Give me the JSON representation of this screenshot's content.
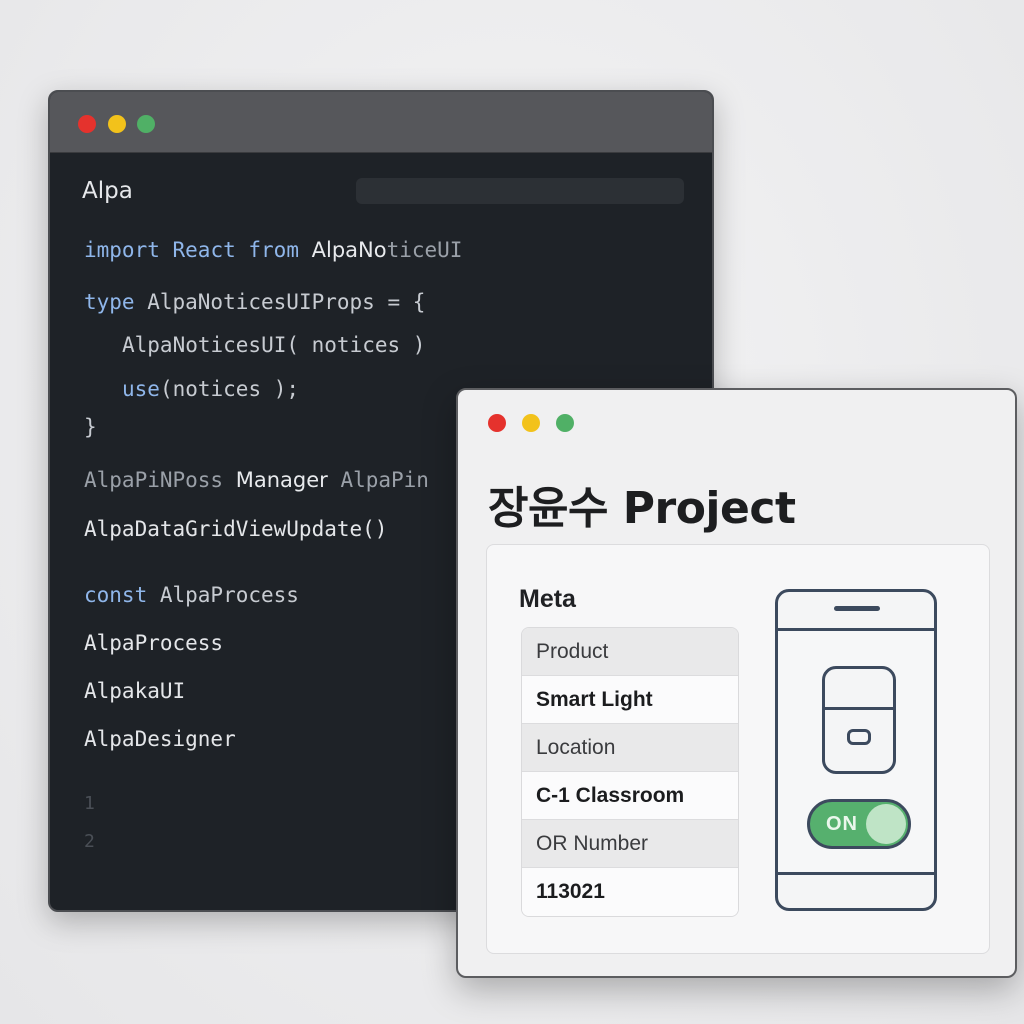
{
  "code_window": {
    "title": "Alpa",
    "lines": {
      "l1_kw1": "import",
      "l1_kw2": "React",
      "l1_kw3": "from",
      "l1_a": "Alpa",
      "l1_b": "No",
      "l1_c": "ticeUI",
      "l2_kw": "type",
      "l2_rest": " AlpaNoticesUIProps = {",
      "l3": "AlpaNoticesUI( notices )",
      "l4_kw": "use",
      "l4_rest": "(notices );",
      "l5": "}",
      "l6_a": "AlpaPiNPoss",
      "l6_b": "Manager",
      "l6_c": "AlpaPin",
      "l7": "AlpaDataGridViewUpdate()",
      "l8_kw": "const",
      "l8_rest": " AlpaProcess",
      "l9": "AlpaProcess",
      "l10": "AlpakaUI",
      "l11": "AlpaDesigner",
      "g1": "1",
      "g2": "2"
    }
  },
  "meta_window": {
    "title": "장윤수 Project",
    "heading": "Meta",
    "fields": [
      {
        "label": "Product",
        "value": "Smart Light"
      },
      {
        "label": "Location",
        "value": "C-1 Classroom"
      },
      {
        "label": "OR Number",
        "value": "113021"
      }
    ],
    "toggle": {
      "label": "ON",
      "state": "on",
      "color": "#56b06e"
    }
  },
  "colors": {
    "traffic_red": "#e5322d",
    "traffic_yellow": "#f2c21b",
    "traffic_green": "#50b066",
    "keyword": "#8fb6ea"
  }
}
